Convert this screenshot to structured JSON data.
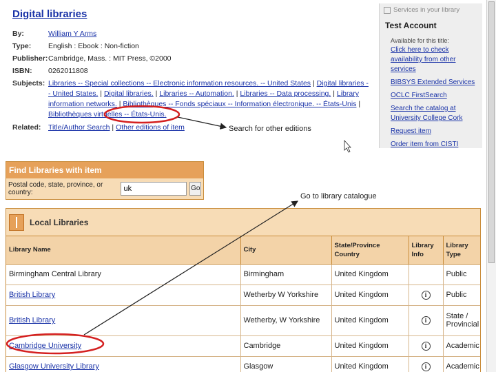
{
  "record": {
    "title": "Digital libraries",
    "fields": [
      {
        "key": "By:",
        "value": "William Y Arms",
        "link": true
      },
      {
        "key": "Type:",
        "value": "English : Ebook : Non-fiction",
        "link": false
      },
      {
        "key": "Publisher:",
        "value": "Cambridge, Mass. : MIT Press, ©2000",
        "link": false
      },
      {
        "key": "ISBN:",
        "value": "0262011808",
        "link": false
      }
    ],
    "subjects_label": "Subjects:",
    "subjects": [
      "Libraries -- Special collections -- Electronic information resources. -- United States",
      "Digital libraries -- United States.",
      "Digital libraries.",
      "Libraries -- Automation.",
      "Libraries -- Data processing.",
      "Library information networks.",
      "Bibliothèques -- Fonds spéciaux -- Information électronique. -- États-Unis",
      "Bibliothèques virtuelles -- États-Unis."
    ],
    "related_label": "Related:",
    "related_links": [
      "Title/Author Search",
      "Other editions of item"
    ]
  },
  "services": {
    "header": "Services in your library",
    "account": "Test Account",
    "note": "Available for this title:",
    "items": [
      "Click here to check availability from other services",
      "BIBSYS Extended Services",
      "OCLC FirstSearch",
      "Search the catalog at University College Cork",
      "Request item",
      "Order item from CISTI"
    ]
  },
  "find": {
    "title": "Find Libraries with item",
    "label": "Postal code, state, province, or country:",
    "value": "uk",
    "go": "Go"
  },
  "local": {
    "title": "Local Libraries",
    "columns": [
      "Library Name",
      "City",
      "State/Province Country",
      "Library Info",
      "Library Type"
    ],
    "rows": [
      {
        "name": "Birmingham Central Library",
        "link": false,
        "city": "Birmingham",
        "country": "United Kingdom",
        "info": false,
        "type": "Public"
      },
      {
        "name": "British Library",
        "link": true,
        "city": "Wetherby W Yorkshire",
        "country": "United Kingdom",
        "info": true,
        "type": "Public"
      },
      {
        "name": "British Library",
        "link": true,
        "city": "Wetherby, W Yorkshire",
        "country": "United Kingdom",
        "info": true,
        "type": "State / Provincial"
      },
      {
        "name": "Cambridge University",
        "link": true,
        "city": "Cambridge",
        "country": "United Kingdom",
        "info": true,
        "type": "Academic"
      },
      {
        "name": "Glasgow University Library",
        "link": true,
        "city": "Glasgow",
        "country": "United Kingdom",
        "info": true,
        "type": "Academic"
      }
    ]
  },
  "annotations": {
    "editions": "Search for other editions",
    "catalogue": "Go to library catalogue"
  },
  "colors": {
    "link": "#1a33a8",
    "orange": "#e6a15a",
    "highlight": "#d42020"
  }
}
